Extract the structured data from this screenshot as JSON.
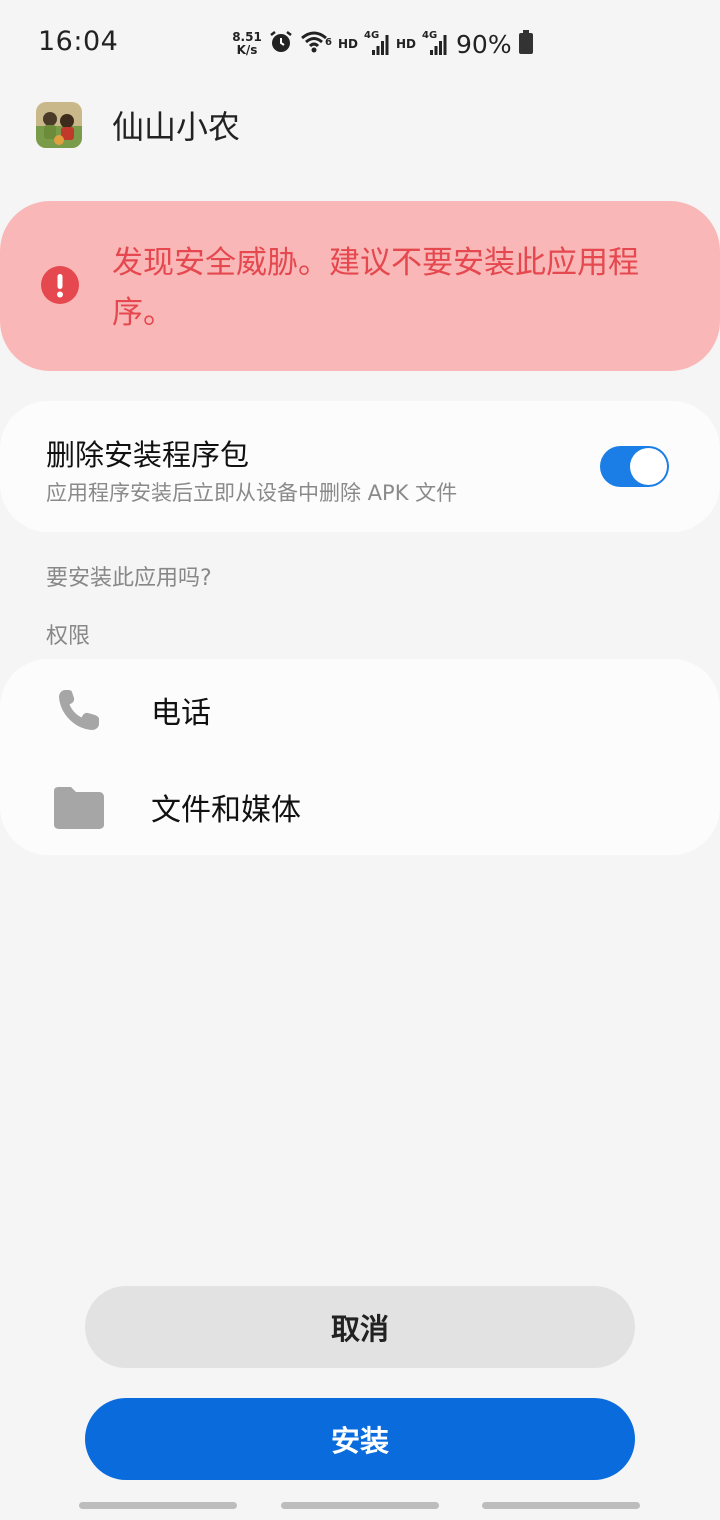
{
  "status_bar": {
    "time": "16:04",
    "net_speed_value": "8.51",
    "net_speed_unit": "K/s",
    "hd_label_1": "HD",
    "hd_label_2": "HD",
    "network_label_1": "4G",
    "network_label_2": "4G",
    "battery": "90%"
  },
  "app": {
    "name": "仙山小农",
    "icon": "farm-game-app-icon"
  },
  "threat_warning": {
    "text": "发现安全威胁。建议不要安装此应用程序。",
    "icon": "exclamation-circle-icon",
    "color": "#e5484f",
    "background": "#f9b8b7"
  },
  "delete_package": {
    "title": "删除安装程序包",
    "subtitle": "应用程序安装后立即从设备中删除 APK 文件",
    "enabled": true,
    "accent": "#1a7ee6"
  },
  "install_question": "要安装此应用吗?",
  "permissions": {
    "header": "权限",
    "items": [
      {
        "label": "电话",
        "icon": "phone-icon"
      },
      {
        "label": "文件和媒体",
        "icon": "folder-icon"
      }
    ]
  },
  "buttons": {
    "cancel": "取消",
    "install": "安装",
    "install_color": "#0a6bdd"
  }
}
